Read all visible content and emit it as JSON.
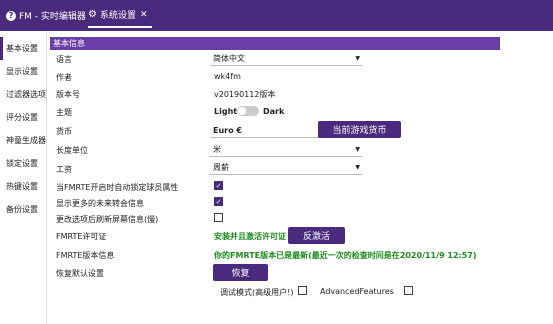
{
  "titlebar": {
    "tab1_icon": "help-badge-icon",
    "tab1_badge": "?",
    "tab1_label": "FM - 实时编辑器",
    "tab2_label": "系统设置",
    "tab2_close": "✕"
  },
  "sidebar": {
    "items": [
      {
        "label": "基本设置"
      },
      {
        "label": "显示设置"
      },
      {
        "label": "过滤器选项"
      },
      {
        "label": "评分设置"
      },
      {
        "label": "神童生成器"
      },
      {
        "label": "锁定设置"
      },
      {
        "label": "热键设置"
      },
      {
        "label": "备份设置"
      }
    ]
  },
  "main": {
    "section_title": "基本信息",
    "language": {
      "label": "语言",
      "value": "简体中文"
    },
    "author": {
      "label": "作者",
      "value": "wk4fm"
    },
    "version": {
      "label": "版本号",
      "value": "v20190112版本"
    },
    "theme": {
      "label": "主题",
      "light": "Light",
      "dark": "Dark"
    },
    "currency": {
      "label": "货币",
      "value": "Euro €",
      "button": "当前游戏货币"
    },
    "length": {
      "label": "长度单位",
      "value": "米"
    },
    "wage": {
      "label": "工资",
      "value": "周薪"
    },
    "checks": [
      {
        "label": "当FMRTE开启时自动锁定球员属性",
        "checked": true
      },
      {
        "label": "显示更多的未来转会信息",
        "checked": true
      },
      {
        "label": "更改选项后刷新屏幕信息(慢)",
        "checked": false
      }
    ],
    "license": {
      "label": "FMRTE许可证",
      "status": "安装并且激活许可证",
      "button": "反激活"
    },
    "fmrte_version": {
      "label": "FMRTE版本信息",
      "status": "你的FMRTE版本已是最新(最近一次的检查时间是在2020/11/9 12:57)"
    },
    "restore": {
      "label": "恢复默认设置",
      "button": "恢复"
    },
    "debug_label": "调试模式(高级用户!)",
    "advanced_label": "AdvancedFeatures"
  },
  "colors": {
    "accent": "#4a2a7d",
    "header": "#6b3fa8",
    "success": "#1e8a1e"
  }
}
